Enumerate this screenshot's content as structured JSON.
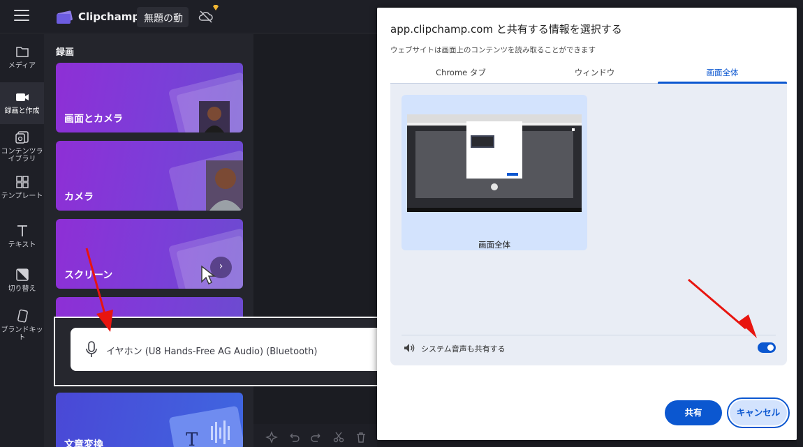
{
  "app": {
    "brand": "Clipchamp",
    "project_name": "無題の動",
    "accent_color": "#7b3ed8"
  },
  "nav": {
    "items": [
      {
        "label": "メディア",
        "icon": "folder-icon"
      },
      {
        "label": "録画と作成",
        "icon": "video-camera-icon"
      },
      {
        "label": "コンテンツライブラリ",
        "icon": "content-library-icon"
      },
      {
        "label": "テンプレート",
        "icon": "templates-icon"
      },
      {
        "label": "テキスト",
        "icon": "text-icon"
      },
      {
        "label": "切り替え",
        "icon": "transitions-icon"
      },
      {
        "label": "ブランドキット",
        "icon": "brand-kit-icon"
      }
    ]
  },
  "panel": {
    "title": "録画",
    "cards": [
      {
        "label": "画面とカメラ"
      },
      {
        "label": "カメラ"
      },
      {
        "label": "スクリーン"
      },
      {
        "label": ""
      },
      {
        "label": "文章変換"
      }
    ]
  },
  "microphone": {
    "selected_device": "イヤホン (U8 Hands-Free AG Audio) (Bluetooth)"
  },
  "dialog": {
    "title": "app.clipchamp.com と共有する情報を選択する",
    "subtitle": "ウェブサイトは画面上のコンテンツを読み取ることができます",
    "tabs": [
      {
        "label": "Chrome タブ",
        "active": false
      },
      {
        "label": "ウィンドウ",
        "active": false
      },
      {
        "label": "画面全体",
        "active": true
      }
    ],
    "screen_option_label": "画面全体",
    "system_audio_label": "システム音声も共有する",
    "system_audio_enabled": true,
    "share_button": "共有",
    "cancel_button": "キャンセル",
    "primary_color": "#0b57d0"
  },
  "annotation": {
    "arrow_color": "#e8150f"
  }
}
